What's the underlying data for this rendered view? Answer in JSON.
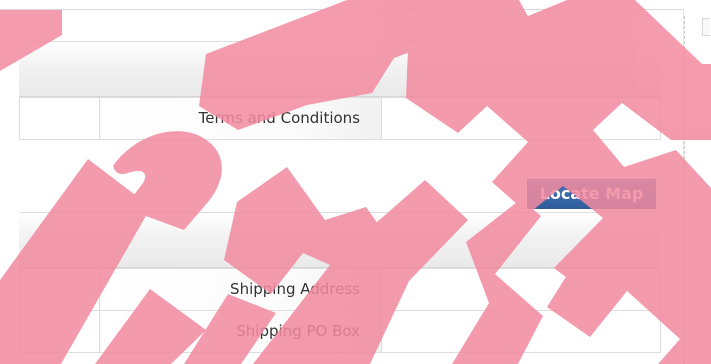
{
  "terms_section": {
    "label": "Terms and Conditions",
    "value": ""
  },
  "map": {
    "button_label": "Locate Map"
  },
  "shipping_section": {
    "rows": [
      {
        "label": "Shipping Address",
        "value": ""
      },
      {
        "label": "Shipping PO Box",
        "value": ""
      }
    ]
  },
  "colors": {
    "button": "#2f5e9f",
    "watermark": "#f28aa0"
  },
  "icons": {
    "watermark": "watermark-overlay"
  }
}
